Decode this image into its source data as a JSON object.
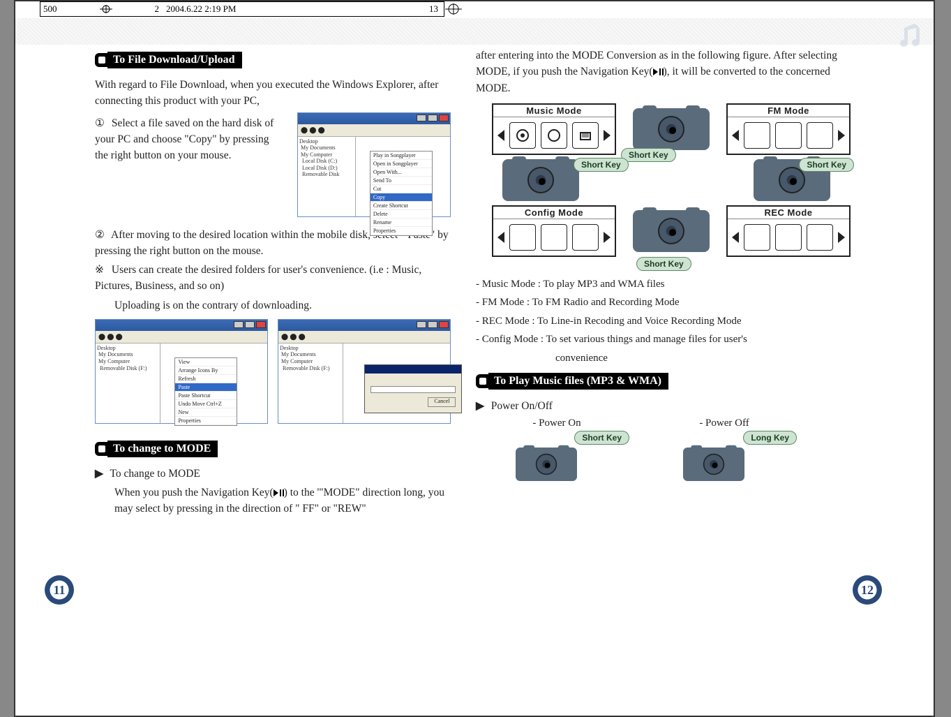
{
  "header": {
    "doc": "500",
    "sheet": "2",
    "timestamp": "2004.6.22 2:19 PM",
    "page": "13"
  },
  "left": {
    "s1": {
      "title": "To File Download/Upload"
    },
    "p1": "With regard to File Download, when you executed the Windows Explorer, after connecting this product with your PC,",
    "n1": "①",
    "p2": "Select a file saved on the hard disk of your PC and choose \"Copy\" by pressing the right button on your mouse.",
    "n2": "②",
    "p3": "After moving to the desired location within the mobile disk, select \" Paste\" by pressing the right button on the mouse.",
    "star": "※",
    "p4": "Users can create the desired folders for user's convenience. (i.e : Music, Pictures, Business, and so on)",
    "p5": "Uploading is on the contrary of downloading.",
    "s2": {
      "title": "To change to MODE"
    },
    "h2": "To change to MODE",
    "p6a": "When you push the Navigation Key(",
    "p6b": ") to the '\"MODE\" direction long, you may select by pressing in the direction of \" FF\" or \"REW\"",
    "pagenum": "11",
    "ctx": {
      "i1": "Play in Songplayer",
      "i2": "Open in Songplayer",
      "i3": "Open With...",
      "i4": "Send To",
      "i5": "Cut",
      "i6": "Copy",
      "i7": "Create Shortcut",
      "i8": "Delete",
      "i9": "Rename",
      "i10": "Properties"
    },
    "ctx2": {
      "i1": "View",
      "i2": "Arrange Icons By",
      "i3": "Refresh",
      "i4": "Paste",
      "i5": "Paste Shortcut",
      "i6": "Undo Move    Ctrl+Z",
      "i7": "New",
      "i8": "Properties"
    },
    "copy": {
      "cancel": "Cancel"
    }
  },
  "right": {
    "p1a": "after entering into the MODE Conversion as in the following figure. After selecting MODE, if you push the Navigation Key(",
    "p1b": "), it will be converted to the concerned MODE.",
    "modes": {
      "music": "Music Mode",
      "fm": "FM Mode",
      "config": "Config Mode",
      "rec": "REC  Mode"
    },
    "shortkey": "Short Key",
    "longkey": "Long Key",
    "b1": "- Music Mode : To play MP3 and WMA files",
    "b2": "- FM Mode : To FM Radio and Recording Mode",
    "b3": "- REC Mode : To Line-in Recoding and Voice Recording Mode",
    "b4": "- Config Mode : To set various things and manage files for user's",
    "b4b": "convenience",
    "s3": {
      "title": "To Play Music files (MP3 & WMA)"
    },
    "h3": "Power On/Off",
    "pon": "- Power On",
    "poff": "- Power Off",
    "pagenum": "12"
  }
}
